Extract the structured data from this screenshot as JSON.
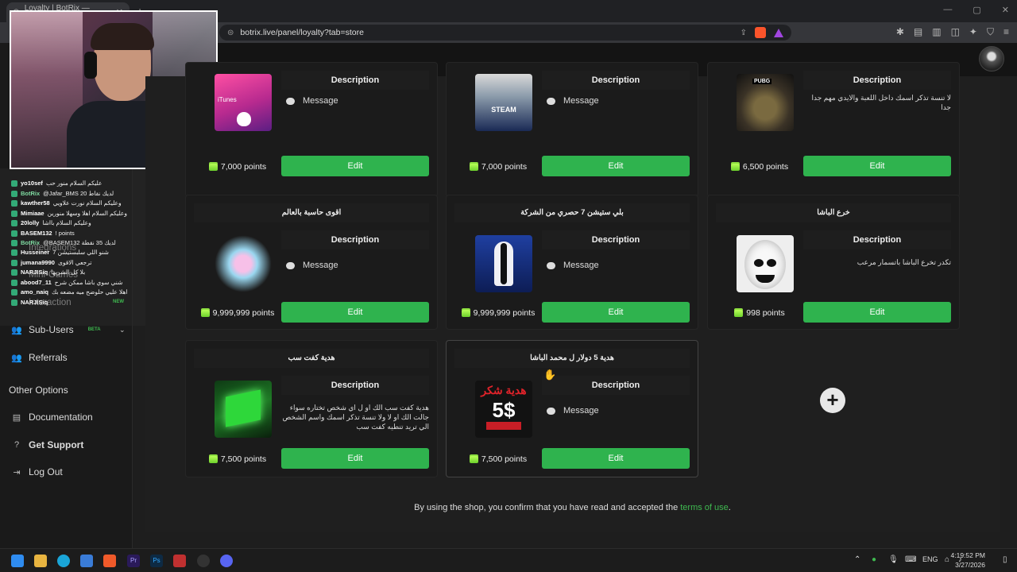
{
  "browser": {
    "tab_title": "Loyalty | BotRix — Cloud Strea...",
    "url": "botrix.live/panel/loyalty?tab=store"
  },
  "webcam": {
    "label": "streamer-webcam"
  },
  "chat": [
    {
      "user": "yo10sef",
      "text": "عليكم السلام منور حب"
    },
    {
      "user": "BotRix",
      "text": "@Jafar_BMS لديك نقاط 20",
      "bot": true
    },
    {
      "user": "kawther58",
      "text": "وعليكم السلام نورت علاويي"
    },
    {
      "user": "Mimiaae",
      "text": "وعليكم السلام اهلا وسهلا منورين"
    },
    {
      "user": "20lolly",
      "text": "وعليكم السلام بااشا"
    },
    {
      "user": "BASEM132",
      "text": "! points"
    },
    {
      "user": "BotRix",
      "text": "@BASEM132 لديك 35 نقطة",
      "bot": true
    },
    {
      "user": "Husseiner",
      "text": "شنو اللي سلبستيشن 7"
    },
    {
      "user": "jumana9990",
      "text": "ترجعي الاقوى"
    },
    {
      "user": "NARJISiq",
      "text": "بلا كل الشريها"
    },
    {
      "user": "abood7_11",
      "text": "شني سوي باشا ممكن شرح"
    },
    {
      "user": "amo_naiq",
      "text": "اهلا عليي حلوضح ميه مضعه بك"
    },
    {
      "user": "NARJISiq",
      "text": ""
    }
  ],
  "sidebar": {
    "ghost_items": [
      "Integrations",
      "Mini-Games",
      "Interaction"
    ],
    "new_badge": "NEW",
    "sub_users": {
      "label": "Sub-Users",
      "badge": "BETA"
    },
    "referrals": "Referrals",
    "other_heading": "Other Options",
    "documentation": "Documentation",
    "support": "Get Support",
    "logout": "Log Out"
  },
  "store": {
    "cards": [
      {
        "title": "",
        "desc_head": "Description",
        "message": "Message",
        "text": "",
        "price": "7,000 points",
        "edit": "Edit",
        "image": "itunes-gift-card",
        "img_label": "iTunes"
      },
      {
        "title": "",
        "desc_head": "Description",
        "message": "Message",
        "text": "",
        "price": "7,000 points",
        "edit": "Edit",
        "image": "steam-gift-card",
        "img_label": "STEAM"
      },
      {
        "title": "",
        "desc_head": "Description",
        "message": "",
        "text": "لا تنسة تذكر اسمك داخل اللعبة والايدي مهم جدا جدا",
        "price": "6,500 points",
        "edit": "Edit",
        "image": "pubg-uc-chest",
        "img_label": "PUBG"
      },
      {
        "title": "اقوى حاسبة بالعالم",
        "desc_head": "Description",
        "message": "Message",
        "text": "",
        "price": "9,999,999 points",
        "edit": "Edit",
        "image": "gaming-pc"
      },
      {
        "title": "بلي ستيشن 7 حصري من الشركة",
        "desc_head": "Description",
        "message": "Message",
        "text": "",
        "price": "9,999,999 points",
        "edit": "Edit",
        "image": "ps5-console"
      },
      {
        "title": "خرع الباشا",
        "desc_head": "Description",
        "message": "",
        "text": "تكدر تخرع الباشا باتسمار مرعب",
        "price": "998 points",
        "edit": "Edit",
        "image": "scary-face"
      },
      {
        "title": "هدية كفت سب",
        "desc_head": "Description",
        "message": "",
        "text": "هدية كفت سب الك او ل اي شخص تختاره سواء جالت الك او لا ولا تنسة تذكر اسمك واسم الشخص الي تريد تنطيه كفت سب",
        "price": "7,500 points",
        "edit": "Edit",
        "image": "gift-sub-kit"
      },
      {
        "title": "هدية 5 دولار ل محمد الباشا",
        "desc_head": "Description",
        "message": "Message",
        "text": "",
        "price": "7,500 points",
        "edit": "Edit",
        "image": "gift-5-dollar",
        "img_label_top": "هدية شكر",
        "img_label_num": "5$"
      }
    ],
    "add_label": "+",
    "footer_prefix": "By using the shop, you confirm that you have read and accepted the ",
    "footer_link": "terms of use",
    "footer_suffix": "."
  },
  "taskbar": {
    "lang": "ENG",
    "time": "4:19:52 PM",
    "date": "3/27/2026"
  },
  "colors": {
    "accent_green": "#2fb34e",
    "link_green": "#3fb950"
  }
}
